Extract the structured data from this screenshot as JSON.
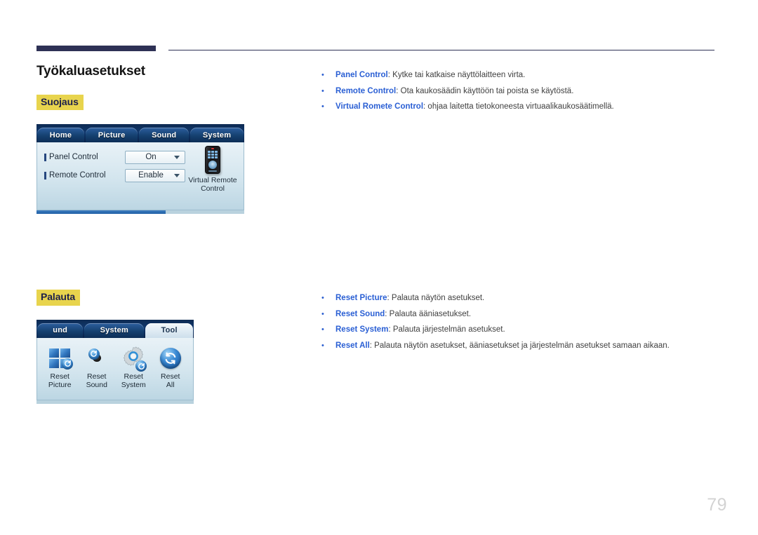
{
  "page": {
    "title": "Työkaluasetukset",
    "number": "79",
    "accent_navy": "#2e3155",
    "highlight_yellow": "#e8d44d",
    "link_blue": "#2a5fd4"
  },
  "sections": [
    {
      "tag": "Suojaus",
      "osd": {
        "name": "security-osd",
        "tabs": [
          {
            "label": "Home",
            "active": false
          },
          {
            "label": "Picture",
            "active": false
          },
          {
            "label": "Sound",
            "active": false
          },
          {
            "label": "System",
            "active": false
          }
        ],
        "rows": [
          {
            "label": "Panel Control",
            "value": "On"
          },
          {
            "label": "Remote Control",
            "value": "Enable"
          }
        ],
        "side_item": {
          "icon": "remote-control-icon",
          "caption_line1": "Virtual Remote",
          "caption_line2": "Control"
        }
      },
      "bullets": [
        {
          "term": "Panel Control",
          "text": ": Kytke tai katkaise näyttölaitteen virta."
        },
        {
          "term": "Remote Control",
          "text": ": Ota kaukosäädin käyttöön tai poista se käytöstä."
        },
        {
          "term": "Virtual Romete Control",
          "text": ": ohjaa laitetta tietokoneesta virtuaalikaukosäätimellä."
        }
      ]
    },
    {
      "tag": "Palauta",
      "osd": {
        "name": "reset-osd",
        "tabs": [
          {
            "label": "und",
            "active": false
          },
          {
            "label": "System",
            "active": false
          },
          {
            "label": "Tool",
            "active": true
          }
        ],
        "items": [
          {
            "icon": "reset-picture-icon",
            "line1": "Reset",
            "line2": "Picture"
          },
          {
            "icon": "reset-sound-icon",
            "line1": "Reset",
            "line2": "Sound"
          },
          {
            "icon": "reset-system-icon",
            "line1": "Reset",
            "line2": "System"
          },
          {
            "icon": "reset-all-icon",
            "line1": "Reset",
            "line2": "All"
          }
        ]
      },
      "bullets": [
        {
          "term": "Reset Picture",
          "text": ": Palauta näytön asetukset."
        },
        {
          "term": "Reset Sound",
          "text": ": Palauta ääniasetukset."
        },
        {
          "term": "Reset System",
          "text": ": Palauta järjestelmän asetukset."
        },
        {
          "term": "Reset All",
          "text": ": Palauta näytön asetukset, ääniasetukset ja järjestelmän asetukset samaan aikaan."
        }
      ]
    }
  ]
}
